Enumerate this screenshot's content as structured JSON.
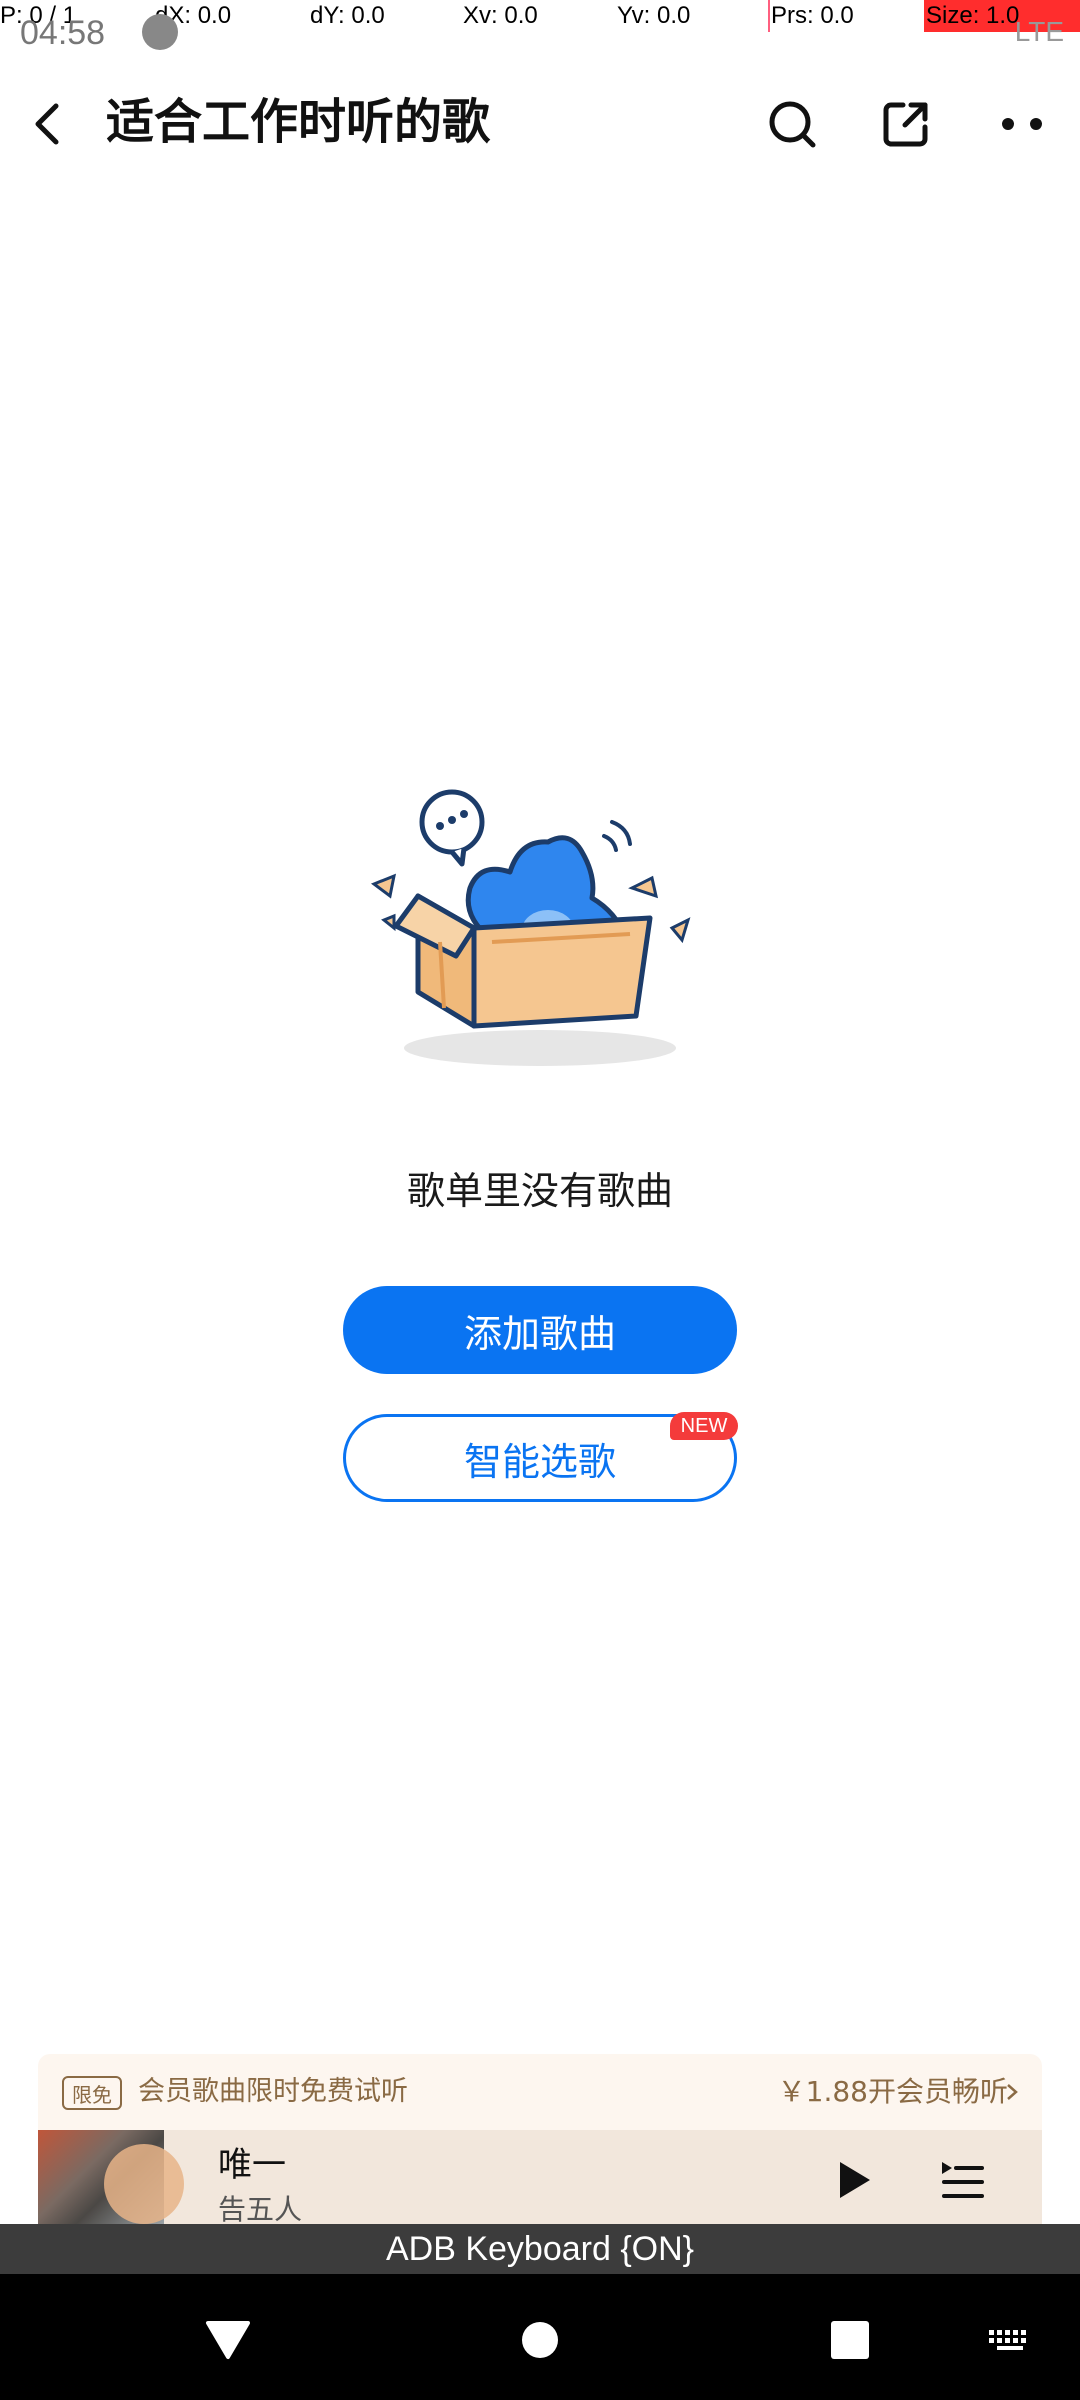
{
  "debug": {
    "pointer": "P: 0 / 1",
    "dx": "dX: 0.0",
    "dy": "dY: 0.0",
    "xv": "Xv: 0.0",
    "yv": "Yv: 0.0",
    "prs": "Prs: 0.0",
    "size": "Size: 1.0"
  },
  "status": {
    "time": "04:58",
    "right": "LTE"
  },
  "header": {
    "title": "适合工作时听的歌",
    "icons": [
      "back-icon",
      "search-icon",
      "share-icon",
      "more-icon"
    ]
  },
  "empty_state": {
    "message": "歌单里没有歌曲",
    "add_button": "添加歌曲",
    "smart_button": "智能选歌",
    "badge": "NEW"
  },
  "promo": {
    "tag": "限免",
    "text": "会员歌曲限时免费试听",
    "price": "￥1.88开会员畅听"
  },
  "player": {
    "title": "唯一",
    "artist": "告五人"
  },
  "keyboard": {
    "label": "ADB Keyboard {ON}"
  },
  "colors": {
    "accent": "#0a74f2",
    "badge": "#f43b3b",
    "promo_text": "#8a6a44"
  }
}
